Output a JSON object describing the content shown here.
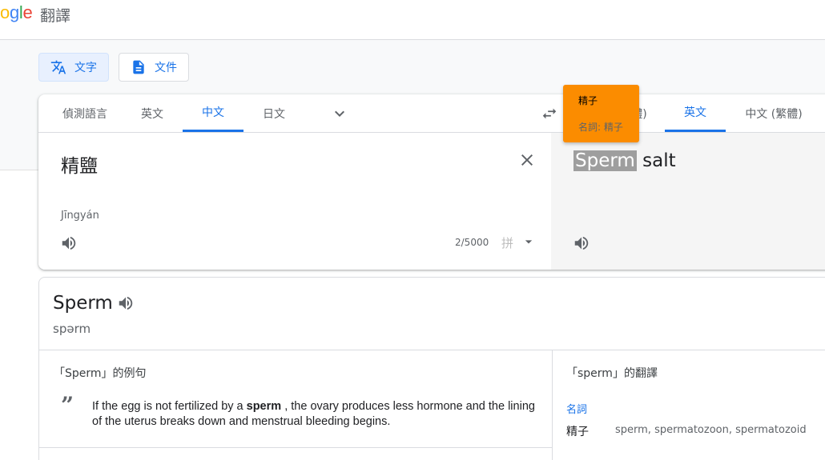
{
  "header": {
    "logo_text": "ogle",
    "app_title": "翻譯"
  },
  "modes": {
    "text_label": "文字",
    "document_label": "文件"
  },
  "source_langs": [
    "偵測語言",
    "英文",
    "中文",
    "日文"
  ],
  "target_langs": [
    "英文",
    "中文 (繁體)"
  ],
  "source": {
    "text": "精鹽",
    "transliteration": "Jīngyán",
    "counter": "2/5000",
    "input_method": "拼"
  },
  "target": {
    "highlight": "Sperm",
    "rest": " salt",
    "hidden_tab_suffix": "體)"
  },
  "tooltip": {
    "line1": "精子",
    "line2": "名詞: 精子"
  },
  "dictionary": {
    "word": "Sperm",
    "phonetic": "spərm",
    "examples_heading": "「Sperm」的例句",
    "example_before": "If the egg is not fertilized by a ",
    "example_bold": "sperm",
    "example_after": " , the ovary produces less hormone and the lining of the uterus breaks down and menstrual bleeding begins.",
    "translations_heading": "「sperm」的翻譯",
    "pos": "名詞",
    "translation": "精子",
    "synonyms": "sperm, spermatozoon, spermatozoid"
  },
  "colors": {
    "accent": "#1a73e8",
    "tooltip": "#fb8c00"
  }
}
